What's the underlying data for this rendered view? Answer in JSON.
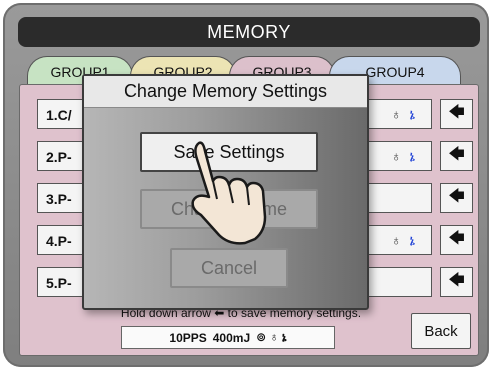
{
  "title": "MEMORY",
  "tabs": [
    {
      "label": "GROUP1"
    },
    {
      "label": "GROUP2"
    },
    {
      "label": "GROUP3"
    },
    {
      "label": "GROUP4"
    }
  ],
  "rows": [
    {
      "label": "1.C/",
      "icons": [
        "♁",
        "ኔ"
      ]
    },
    {
      "label": "2.P-",
      "icons": [
        "♁",
        "ኔ"
      ]
    },
    {
      "label": "3.P-",
      "icons": []
    },
    {
      "label": "4.P-",
      "icons": [
        "♁",
        "ኔ"
      ]
    },
    {
      "label": "5.P-",
      "icons": []
    }
  ],
  "arrow_glyph": "🡄",
  "hint": "Hold down arrow ⬅ to save memory settings.",
  "info": {
    "pps": "10PPS",
    "energy": "400mJ",
    "icons": "⊚ ♁ ኔ"
  },
  "back_label": "Back",
  "dialog": {
    "title": "Change Memory Settings",
    "save_label": "Save Settings",
    "change_name_label": "Change Name",
    "cancel_label": "Cancel"
  },
  "colors": {
    "tab1": "#c7e3c3",
    "tab2": "#ece4b4",
    "tab3": "#dcc0cb",
    "tab4": "#c8d7ec",
    "panel": "#dfc2cd",
    "accent_blue": "#1e40d6"
  }
}
